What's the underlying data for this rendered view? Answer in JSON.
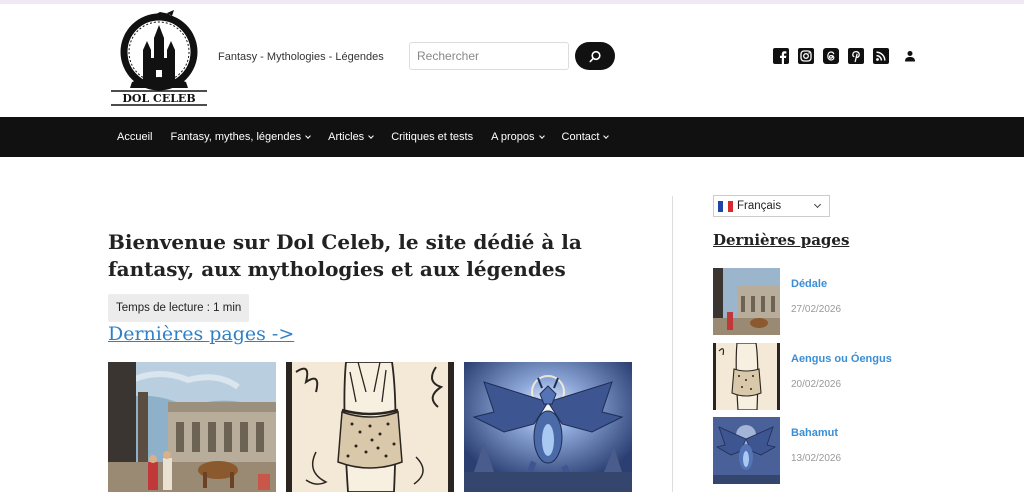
{
  "site": {
    "logo_text": "DOL CELEB",
    "tagline": "Fantasy - Mythologies - Légendes"
  },
  "search": {
    "placeholder": "Rechercher",
    "button_icon": "search-icon"
  },
  "social": [
    "facebook-icon",
    "instagram-icon",
    "threads-icon",
    "pinterest-icon",
    "rss-icon",
    "user-icon"
  ],
  "nav": {
    "items": [
      {
        "label": "Accueil",
        "dropdown": false
      },
      {
        "label": "Fantasy, mythes, légendes",
        "dropdown": true
      },
      {
        "label": "Articles",
        "dropdown": true
      },
      {
        "label": "Critiques et tests",
        "dropdown": false
      },
      {
        "label": "A propos",
        "dropdown": true
      },
      {
        "label": "Contact",
        "dropdown": true
      }
    ]
  },
  "main": {
    "title": "Bienvenue sur Dol Celeb, le site dédié à la fantasy, aux mythologies et aux légendes",
    "reading_time": "Temps de lecture : 1 min",
    "pages_link": "Dernières pages ->"
  },
  "sidebar": {
    "language": "Français",
    "section_title": "Dernières pages",
    "items": [
      {
        "title": "Dédale",
        "date": "27/02/2026"
      },
      {
        "title": "Aengus ou Óengus",
        "date": "20/02/2026"
      },
      {
        "title": "Bahamut",
        "date": "13/02/2026"
      }
    ]
  },
  "colors": {
    "nav_bg": "#111111",
    "link": "#2f80c6",
    "sidebar_link": "#3b8ed4",
    "top_line": "#f1e8f6"
  }
}
